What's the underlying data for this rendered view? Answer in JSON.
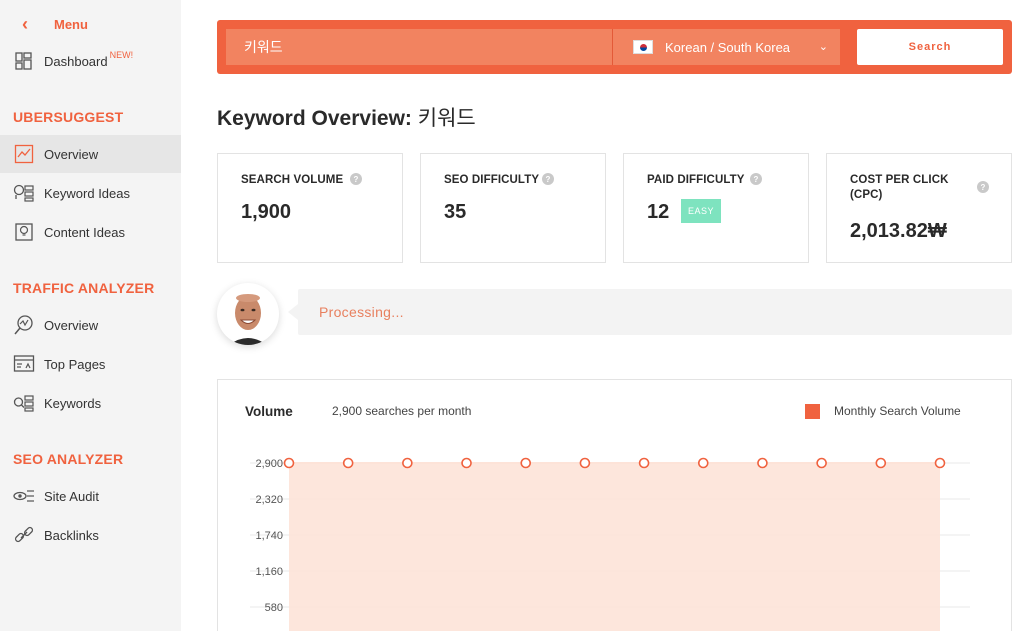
{
  "sidebar": {
    "menu_label": "Menu",
    "dashboard_label": "Dashboard",
    "dashboard_badge": "NEW!",
    "section_ubersuggest": "UBERSUGGEST",
    "ubersuggest_items": [
      "Overview",
      "Keyword Ideas",
      "Content Ideas"
    ],
    "section_traffic": "TRAFFIC ANALYZER",
    "traffic_items": [
      "Overview",
      "Top Pages",
      "Keywords"
    ],
    "section_seo": "SEO ANALYZER",
    "seo_items": [
      "Site Audit",
      "Backlinks"
    ]
  },
  "search": {
    "keyword_value": "키워드",
    "language": "Korean / South Korea",
    "button_label": "Search"
  },
  "title": {
    "prefix": "Keyword Overview:",
    "keyword": "키워드"
  },
  "metrics": {
    "search_volume": {
      "label": "SEARCH VOLUME",
      "value": "1,900"
    },
    "seo_difficulty": {
      "label": "SEO DIFFICULTY",
      "value": "35"
    },
    "paid_difficulty": {
      "label": "PAID DIFFICULTY",
      "value": "12",
      "badge": "EASY"
    },
    "cpc": {
      "label_line1": "COST PER CLICK",
      "label_line2": "(CPC)",
      "value": "2,013.82₩"
    }
  },
  "status": {
    "processing_text": "Processing..."
  },
  "volume_chart": {
    "title": "Volume",
    "subtitle": "2,900 searches per month",
    "legend": "Monthly Search Volume"
  },
  "colors": {
    "accent": "#f0623f",
    "area_fill": "#fde3d8",
    "easy": "#7ee3bf"
  },
  "chart_data": {
    "type": "area",
    "title": "Volume",
    "series": [
      {
        "name": "Monthly Search Volume",
        "values": [
          2900,
          2900,
          2900,
          2900,
          2900,
          2900,
          2900,
          2900,
          2900,
          2900,
          2900,
          2900
        ]
      }
    ],
    "y_ticks": [
      "2,900",
      "2,320",
      "1,740",
      "1,160",
      "580"
    ],
    "ylim": [
      0,
      2900
    ],
    "grid": true,
    "legend_position": "top-right"
  }
}
